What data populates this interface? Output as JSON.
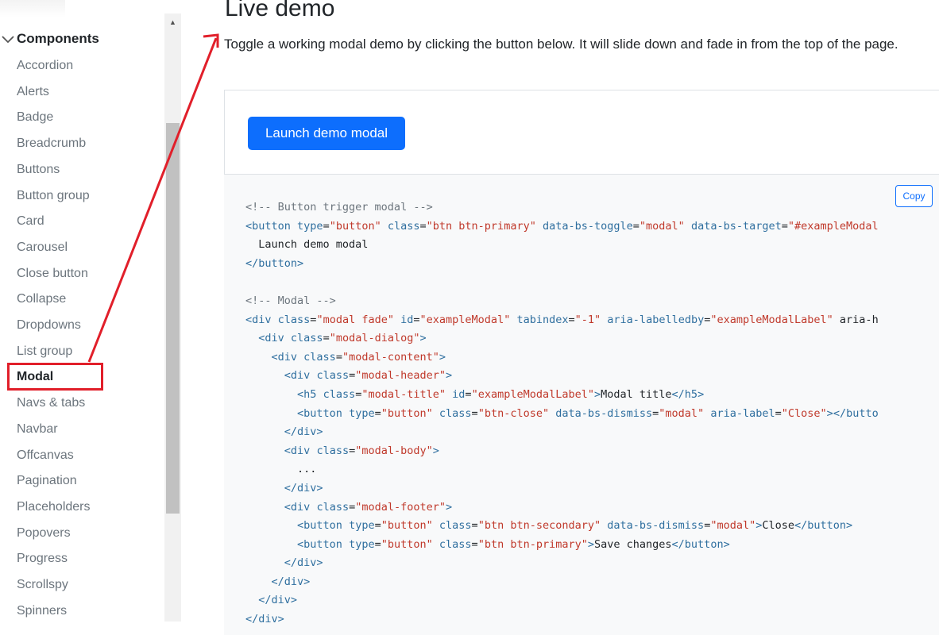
{
  "sidebar": {
    "group_title": "Components",
    "items": [
      {
        "label": "Accordion"
      },
      {
        "label": "Alerts"
      },
      {
        "label": "Badge"
      },
      {
        "label": "Breadcrumb"
      },
      {
        "label": "Buttons"
      },
      {
        "label": "Button group"
      },
      {
        "label": "Card"
      },
      {
        "label": "Carousel"
      },
      {
        "label": "Close button"
      },
      {
        "label": "Collapse"
      },
      {
        "label": "Dropdowns"
      },
      {
        "label": "List group"
      },
      {
        "label": "Modal",
        "active": true
      },
      {
        "label": "Navs & tabs"
      },
      {
        "label": "Navbar"
      },
      {
        "label": "Offcanvas"
      },
      {
        "label": "Pagination"
      },
      {
        "label": "Placeholders"
      },
      {
        "label": "Popovers"
      },
      {
        "label": "Progress"
      },
      {
        "label": "Scrollspy"
      },
      {
        "label": "Spinners"
      }
    ]
  },
  "main": {
    "title": "Live demo",
    "description": "Toggle a working modal demo by clicking the button below. It will slide down and fade in from the top of the page.",
    "demo_button_label": "Launch demo modal",
    "copy_label": "Copy",
    "code_lines": [
      "<!-- Button trigger modal -->",
      "<button type=\"button\" class=\"btn btn-primary\" data-bs-toggle=\"modal\" data-bs-target=\"#exampleModal",
      "  Launch demo modal",
      "</button>",
      "",
      "<!-- Modal -->",
      "<div class=\"modal fade\" id=\"exampleModal\" tabindex=\"-1\" aria-labelledby=\"exampleModalLabel\" aria-h",
      "  <div class=\"modal-dialog\">",
      "    <div class=\"modal-content\">",
      "      <div class=\"modal-header\">",
      "        <h5 class=\"modal-title\" id=\"exampleModalLabel\">Modal title</h5>",
      "        <button type=\"button\" class=\"btn-close\" data-bs-dismiss=\"modal\" aria-label=\"Close\"></butto",
      "      </div>",
      "      <div class=\"modal-body\">",
      "        ...",
      "      </div>",
      "      <div class=\"modal-footer\">",
      "        <button type=\"button\" class=\"btn btn-secondary\" data-bs-dismiss=\"modal\">Close</button>",
      "        <button type=\"button\" class=\"btn btn-primary\">Save changes</button>",
      "      </div>",
      "    </div>",
      "  </div>",
      "</div>"
    ]
  },
  "colors": {
    "primary": "#0d6efd",
    "annotation_red": "#e11f2a",
    "code_tag": "#2f6f9f",
    "code_string": "#c0392b"
  },
  "icons": {
    "group_toggle": "chevron-down-icon",
    "scroll_up": "triangle-up-icon"
  }
}
